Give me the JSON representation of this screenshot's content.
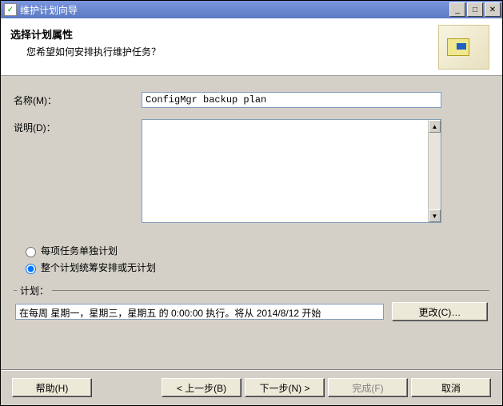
{
  "window": {
    "title": "维护计划向导"
  },
  "header": {
    "title": "选择计划属性",
    "subtitle": "您希望如何安排执行维护任务？"
  },
  "form": {
    "name_label": "名称(M)：",
    "name_value": "ConfigMgr backup plan",
    "desc_label": "说明(D)：",
    "desc_value": ""
  },
  "radios": {
    "separate": "每项任务单独计划",
    "combined": "整个计划统筹安排或无计划"
  },
  "schedule": {
    "legend": "计划：",
    "text": "在每周 星期一，星期三，星期五 的 0:00:00 执行。将从 2014/8/12 开始",
    "change_label": "更改(C)…"
  },
  "buttons": {
    "help": "帮助(H)",
    "back": "< 上一步(B)",
    "next": "下一步(N) >",
    "finish": "完成(F)",
    "cancel": "取消"
  }
}
